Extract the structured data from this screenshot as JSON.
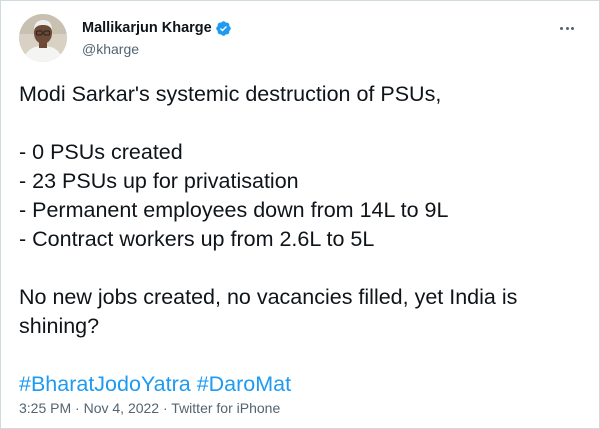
{
  "author": {
    "display_name": "Mallikarjun Kharge",
    "handle": "@kharge",
    "verified": true,
    "avatar_icon": "profile-photo"
  },
  "tweet": {
    "intro": "Modi Sarkar's systemic destruction of PSUs,",
    "points": [
      "- 0 PSUs created",
      "- 23 PSUs up for privatisation",
      "- Permanent employees down from 14L to 9L",
      "- Contract workers up from 2.6L to 5L"
    ],
    "closing": "No new jobs created, no vacancies filled, yet India is shining?",
    "hashtags": [
      "#BharatJodoYatra",
      "#DaroMat"
    ]
  },
  "meta": {
    "time": "3:25 PM",
    "separator": " · ",
    "date": "Nov 4, 2022",
    "source": "Twitter for iPhone"
  },
  "colors": {
    "link": "#1d9bf0",
    "secondary_text": "#536471",
    "primary_text": "#0f1419",
    "verified_badge": "#1d9bf0"
  },
  "icons": {
    "more": "more-options-icon",
    "verified": "verified-badge-icon"
  }
}
